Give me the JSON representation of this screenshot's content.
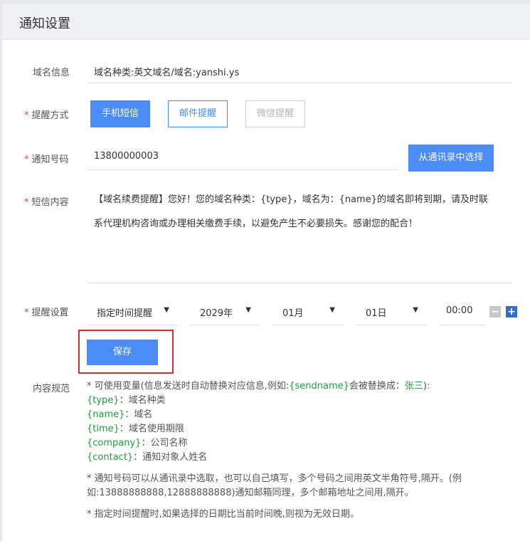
{
  "header": {
    "title": "通知设置"
  },
  "domain_info": {
    "label": "域名信息",
    "value": "域名种类:英文域名/域名:yanshi.ys"
  },
  "remind_method": {
    "required_mark": "*",
    "label": "提醒方式",
    "options": [
      "手机短信",
      "邮件提醒",
      "微信提醒"
    ]
  },
  "notify_number": {
    "required_mark": "*",
    "label": "通知号码",
    "value": "13800000003",
    "contacts_button": "从通讯录中选择"
  },
  "sms_content": {
    "required_mark": "*",
    "label": "短信内容",
    "line1": "【域名续费提醒】您好！您的域名种类：{type}，域名为：{name}的域名即将到期，请及时联",
    "line2": "系代理机构咨询或办理相关缴费手续，以避免产生不必要损失。感谢您的配合！"
  },
  "remind_settings": {
    "required_mark": "*",
    "label": "提醒设置",
    "mode": "指定时间提醒",
    "year": "2029年",
    "month": "01月",
    "day": "01日",
    "time": "00:00",
    "minus_glyph": "−",
    "plus_glyph": "+",
    "caret": "▼"
  },
  "save_button": "保存",
  "rules": {
    "label": "内容规范",
    "intro_prefix": "* 可使用变量(信息发送时自动替换对应信息,例如:",
    "intro_var": "{sendname}",
    "intro_mid": "会被替换成：",
    "intro_example": "张三",
    "intro_suffix": "):",
    "variables": [
      {
        "key": "{type}",
        "desc": "：域名种类"
      },
      {
        "key": "{name}",
        "desc": "：域名"
      },
      {
        "key": "{time}",
        "desc": "：域名使用期限"
      },
      {
        "key": "{company}",
        "desc": "：公司名称"
      },
      {
        "key": "{contact}",
        "desc": "：通知对象人姓名"
      }
    ],
    "note1_line1": "* 通知号码可以从通讯录中选取，也可以自己填写，多个号码之间用英文半角符号,隔开。(例",
    "note1_line2": "如:13888888888,12888888888)通知邮箱同理，多个邮箱地址之间用,隔开。",
    "note2": "* 指定时间提醒时,如果选择的日期比当前时间晚,则视为无效日期。"
  },
  "colors": {
    "accent": "#4b8cf5",
    "required": "#e4393c",
    "variable_green": "#1e9c3c",
    "highlight_red": "#e02b2b"
  }
}
